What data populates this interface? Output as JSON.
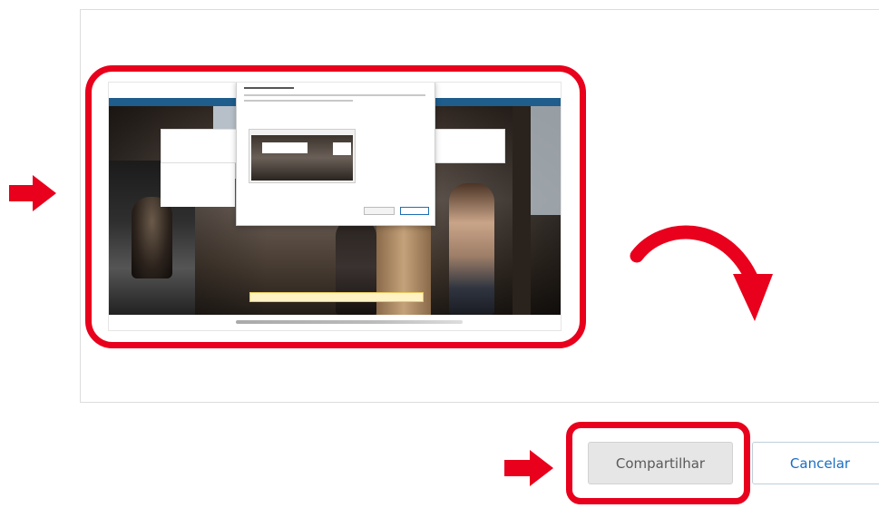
{
  "buttons": {
    "share_label": "Compartilhar",
    "cancel_label": "Cancelar"
  },
  "colors": {
    "annotation_red": "#e8001c",
    "share_button_bg": "#e6e6e6",
    "cancel_text": "#1a6ec1"
  },
  "icons": {
    "left_arrow": "arrow-right-icon",
    "button_arrow": "arrow-right-icon",
    "curved_arrow": "curved-arrow-icon"
  }
}
